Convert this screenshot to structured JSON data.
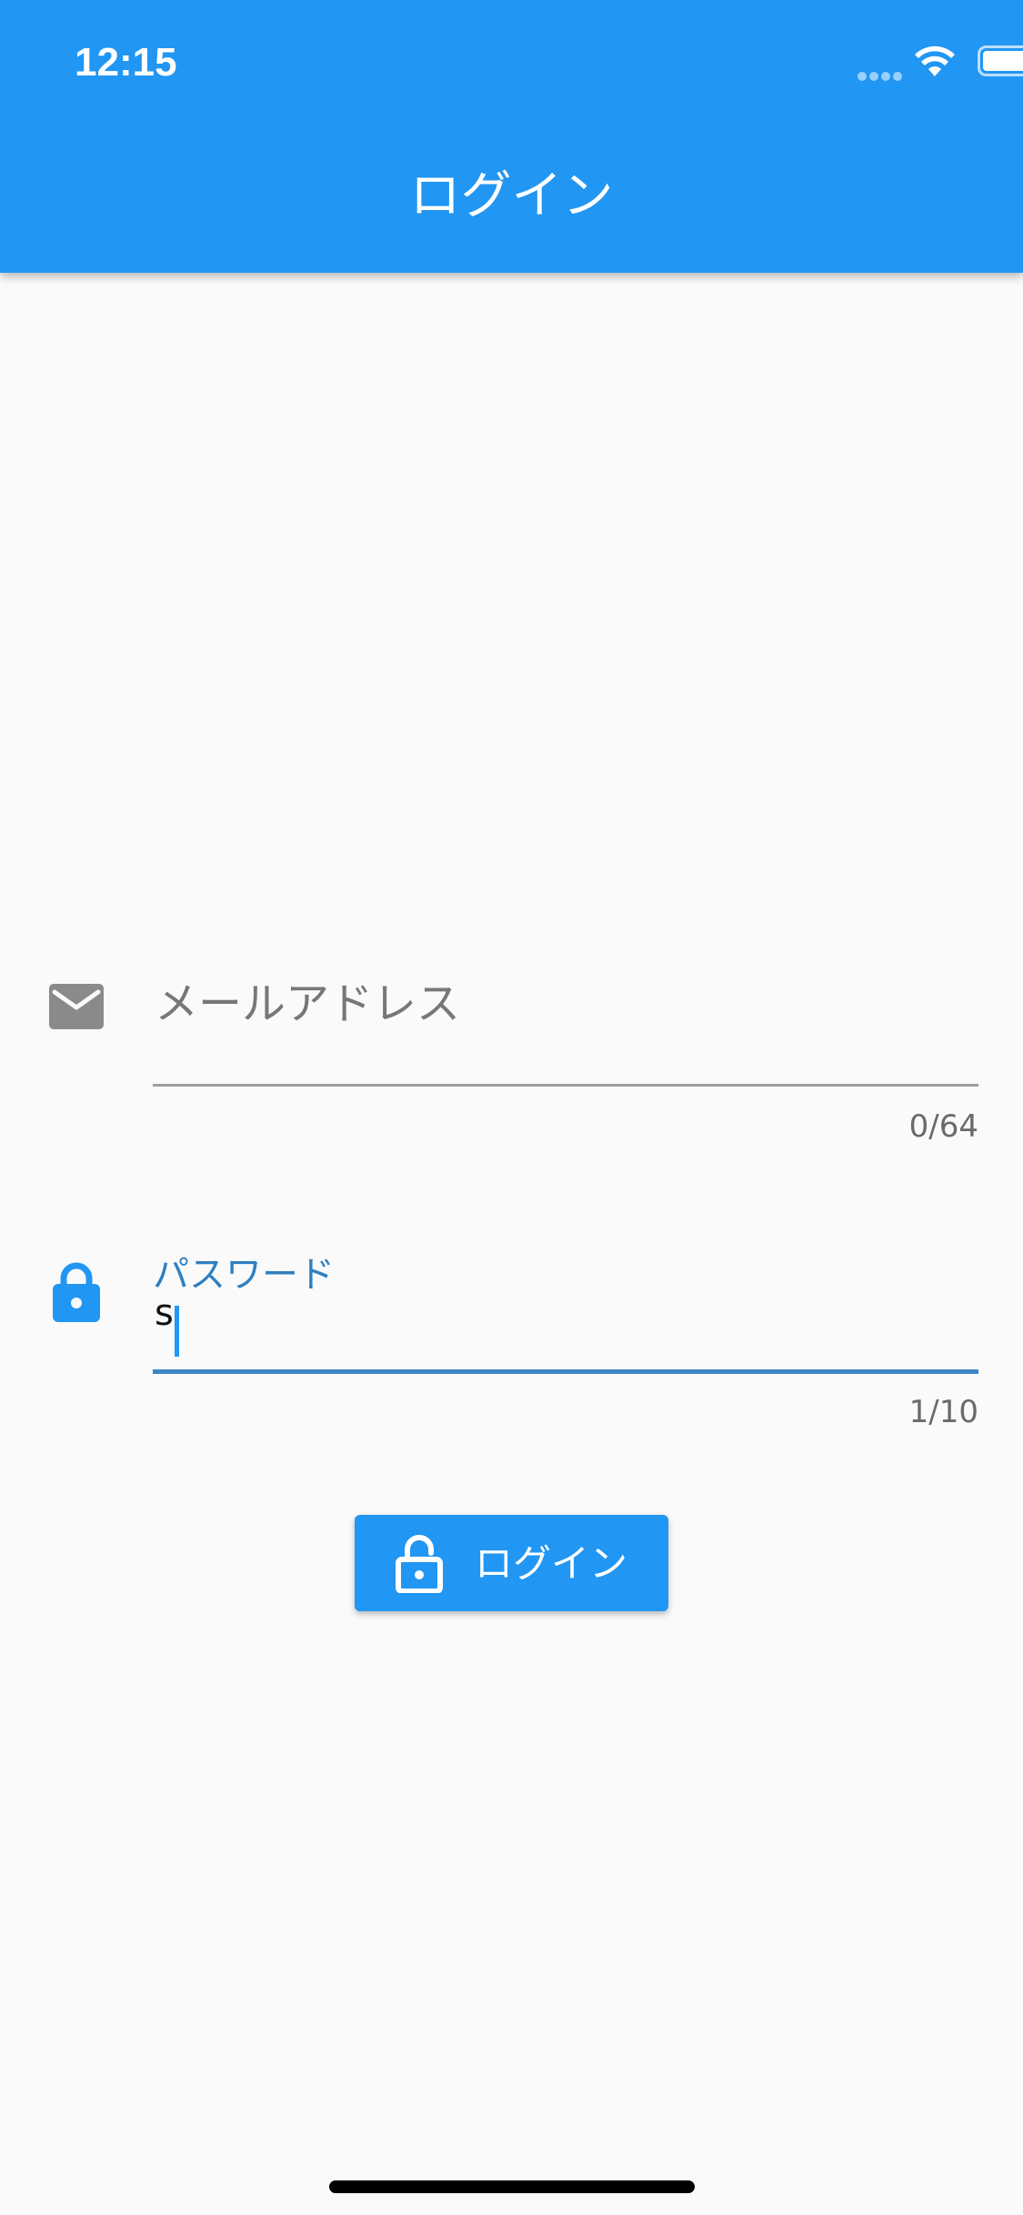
{
  "status_bar": {
    "time": "12:15",
    "icons": [
      "signal-dots-icon",
      "wifi-icon",
      "battery-icon"
    ]
  },
  "app_bar": {
    "title": "ログイン",
    "color": "#2196f3"
  },
  "form": {
    "email": {
      "icon": "mail-icon",
      "placeholder": "メールアドレス",
      "value": "",
      "counter": "0/64"
    },
    "password": {
      "icon": "lock-icon",
      "label": "パスワード",
      "value": "s",
      "counter": "1/10"
    },
    "login_button": {
      "icon": "lock-open-icon",
      "label": "ログイン"
    }
  },
  "colors": {
    "primary": "#2196f3",
    "background": "#fafafa",
    "focused_label": "#2f7fc0",
    "inactive_icon": "#8a8a8a"
  }
}
